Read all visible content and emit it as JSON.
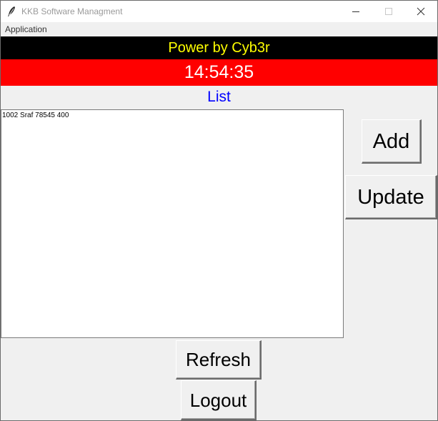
{
  "window": {
    "title": "KKB Software Managment",
    "icon": "feather-icon",
    "controls": [
      "minimize-icon",
      "maximize-icon",
      "close-icon"
    ]
  },
  "menu": {
    "items": [
      "Application"
    ]
  },
  "banner": {
    "text": "Power by Cyb3r",
    "background": "#000000",
    "color": "#ffff00"
  },
  "clock": {
    "time": "14:54:35",
    "background": "#ff0000",
    "color": "#ffffff"
  },
  "list": {
    "title": "List",
    "title_color": "#0000ff",
    "items": [
      "1002 Sraf 78545 400"
    ]
  },
  "buttons": {
    "add": "Add",
    "update": "Update",
    "refresh": "Refresh",
    "logout": "Logout"
  }
}
